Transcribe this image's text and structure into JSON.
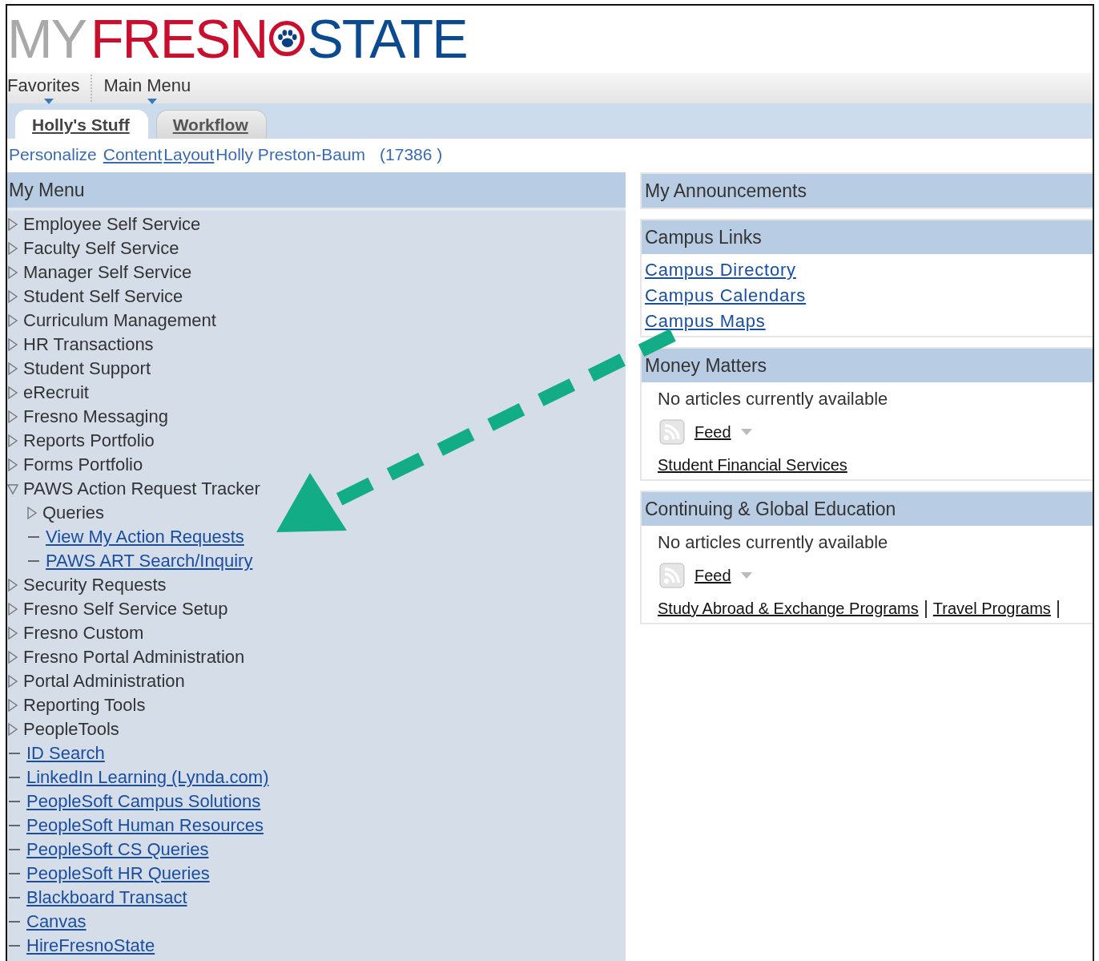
{
  "logo": {
    "my": "MY",
    "fresno": "FRESN",
    "state": "STATE"
  },
  "menubar": [
    {
      "label": "Favorites"
    },
    {
      "label": "Main Menu"
    }
  ],
  "tabs": [
    {
      "label": "Holly's Stuff",
      "selected": true
    },
    {
      "label": "Workflow",
      "selected": false
    }
  ],
  "personalize": {
    "label": "Personalize",
    "links": [
      "Content",
      "Layout"
    ],
    "user": "Holly Preston-Baum",
    "id": "(17386 )"
  },
  "my_menu": {
    "title": "My Menu",
    "items": [
      {
        "kind": "folder",
        "label": "Employee Self Service",
        "expanded": false
      },
      {
        "kind": "folder",
        "label": "Faculty Self Service",
        "expanded": false
      },
      {
        "kind": "folder",
        "label": "Manager Self Service",
        "expanded": false
      },
      {
        "kind": "folder",
        "label": "Student Self Service",
        "expanded": false
      },
      {
        "kind": "folder",
        "label": "Curriculum Management",
        "expanded": false
      },
      {
        "kind": "folder",
        "label": "HR Transactions",
        "expanded": false
      },
      {
        "kind": "folder",
        "label": "Student Support",
        "expanded": false
      },
      {
        "kind": "folder",
        "label": "eRecruit",
        "expanded": false
      },
      {
        "kind": "folder",
        "label": "Fresno Messaging",
        "expanded": false
      },
      {
        "kind": "folder",
        "label": "Reports Portfolio",
        "expanded": false
      },
      {
        "kind": "folder",
        "label": "Forms Portfolio",
        "expanded": false
      },
      {
        "kind": "folder",
        "label": "PAWS Action Request Tracker",
        "expanded": true,
        "children": [
          {
            "kind": "folder",
            "label": "Queries",
            "expanded": false
          },
          {
            "kind": "link",
            "label": "View My Action Requests"
          },
          {
            "kind": "link",
            "label": "PAWS ART Search/Inquiry"
          }
        ]
      },
      {
        "kind": "folder",
        "label": "Security Requests",
        "expanded": false
      },
      {
        "kind": "folder",
        "label": "Fresno Self Service Setup",
        "expanded": false
      },
      {
        "kind": "folder",
        "label": "Fresno Custom",
        "expanded": false
      },
      {
        "kind": "folder",
        "label": "Fresno Portal Administration",
        "expanded": false
      },
      {
        "kind": "folder",
        "label": "Portal Administration",
        "expanded": false
      },
      {
        "kind": "folder",
        "label": "Reporting Tools",
        "expanded": false
      },
      {
        "kind": "folder",
        "label": "PeopleTools",
        "expanded": false
      },
      {
        "kind": "link",
        "label": "ID Search"
      },
      {
        "kind": "link",
        "label": "LinkedIn Learning (Lynda.com)"
      },
      {
        "kind": "link",
        "label": "PeopleSoft Campus Solutions"
      },
      {
        "kind": "link",
        "label": "PeopleSoft Human Resources"
      },
      {
        "kind": "link",
        "label": "PeopleSoft CS Queries"
      },
      {
        "kind": "link",
        "label": "PeopleSoft HR Queries"
      },
      {
        "kind": "link",
        "label": "Blackboard Transact"
      },
      {
        "kind": "link",
        "label": "Canvas"
      },
      {
        "kind": "link",
        "label": "HireFresnoState"
      }
    ]
  },
  "pagelets": [
    {
      "kind": "empty",
      "title": "My Announcements"
    },
    {
      "kind": "links",
      "title": "Campus Links",
      "links": [
        "Campus Directory",
        "Campus Calendars",
        "Campus Maps"
      ]
    },
    {
      "kind": "feed",
      "title": "Money Matters",
      "message": "No articles currently available",
      "feed": "Feed",
      "links": [
        "Student Financial Services"
      ]
    },
    {
      "kind": "feed",
      "title": "Continuing & Global Education",
      "message": "No articles currently available",
      "feed": "Feed",
      "links": [
        "Study Abroad & Exchange Programs",
        "Travel Programs"
      ]
    }
  ]
}
